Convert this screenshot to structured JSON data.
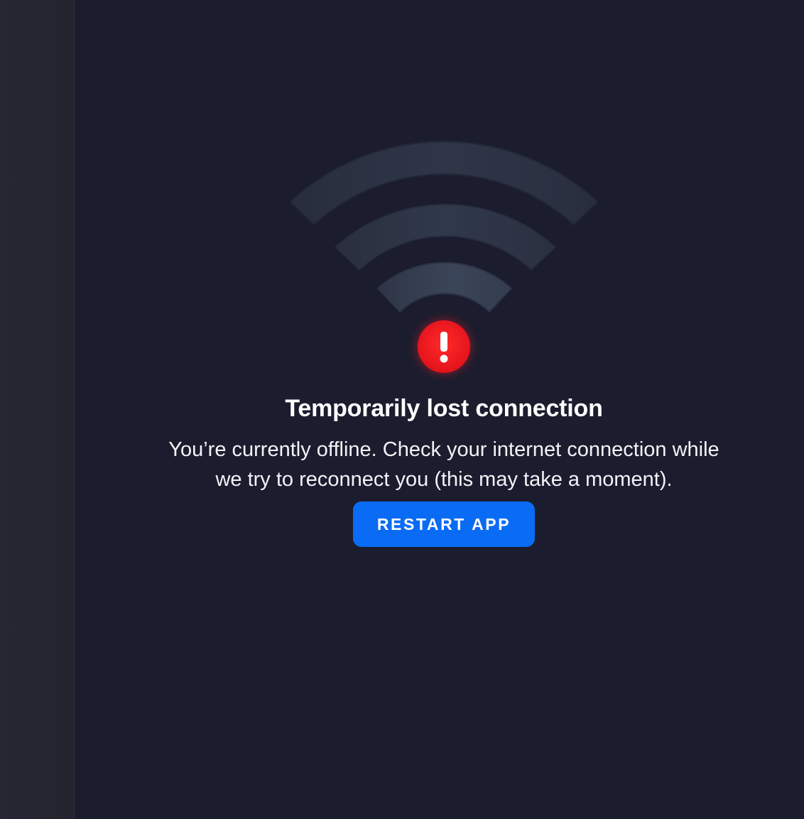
{
  "status": {
    "title": "Temporarily lost connection",
    "message_line1": "You’re currently offline. Check your internet connection while",
    "message_line2": "we try to reconnect you (this may take a moment)."
  },
  "actions": {
    "restart_label": "RESTART APP"
  },
  "icons": {
    "wifi": "wifi-icon",
    "alert": "exclamation-icon"
  },
  "colors": {
    "background": "#1b1d2e",
    "sidebar": "#272734",
    "alert_red": "#e4141c",
    "button_blue": "#0a6cf5"
  }
}
